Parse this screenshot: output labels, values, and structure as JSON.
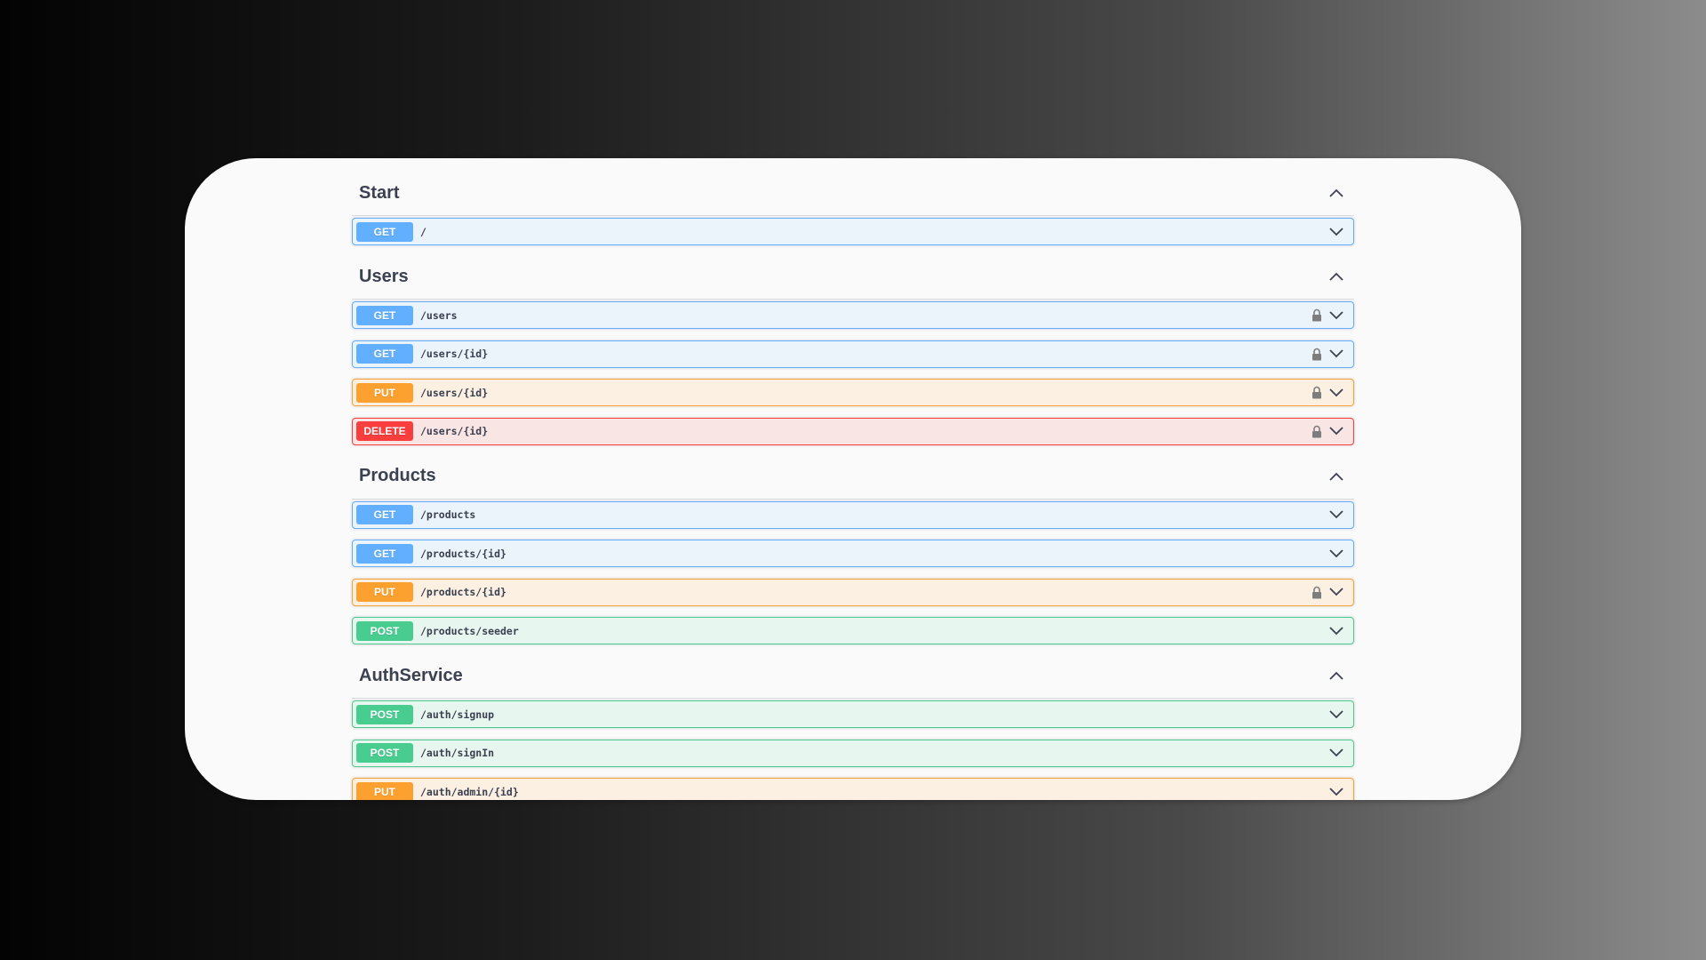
{
  "colors": {
    "get": "#61affe",
    "put": "#fca130",
    "delete": "#f93e3e",
    "post": "#49cc90",
    "text": "#3b4151"
  },
  "icons": {
    "section_toggle": "chevron-up-icon",
    "operation_toggle": "chevron-down-icon",
    "auth": "lock-icon"
  },
  "sections": [
    {
      "title": "Start",
      "operations": [
        {
          "method": "GET",
          "path": "/",
          "locked": false
        }
      ]
    },
    {
      "title": "Users",
      "operations": [
        {
          "method": "GET",
          "path": "/users",
          "locked": true
        },
        {
          "method": "GET",
          "path": "/users/{id}",
          "locked": true
        },
        {
          "method": "PUT",
          "path": "/users/{id}",
          "locked": true
        },
        {
          "method": "DELETE",
          "path": "/users/{id}",
          "locked": true
        }
      ]
    },
    {
      "title": "Products",
      "operations": [
        {
          "method": "GET",
          "path": "/products",
          "locked": false
        },
        {
          "method": "GET",
          "path": "/products/{id}",
          "locked": false
        },
        {
          "method": "PUT",
          "path": "/products/{id}",
          "locked": true
        },
        {
          "method": "POST",
          "path": "/products/seeder",
          "locked": false
        }
      ]
    },
    {
      "title": "AuthService",
      "operations": [
        {
          "method": "POST",
          "path": "/auth/signup",
          "locked": false
        },
        {
          "method": "POST",
          "path": "/auth/signIn",
          "locked": false
        },
        {
          "method": "PUT",
          "path": "/auth/admin/{id}",
          "locked": false
        }
      ]
    }
  ]
}
